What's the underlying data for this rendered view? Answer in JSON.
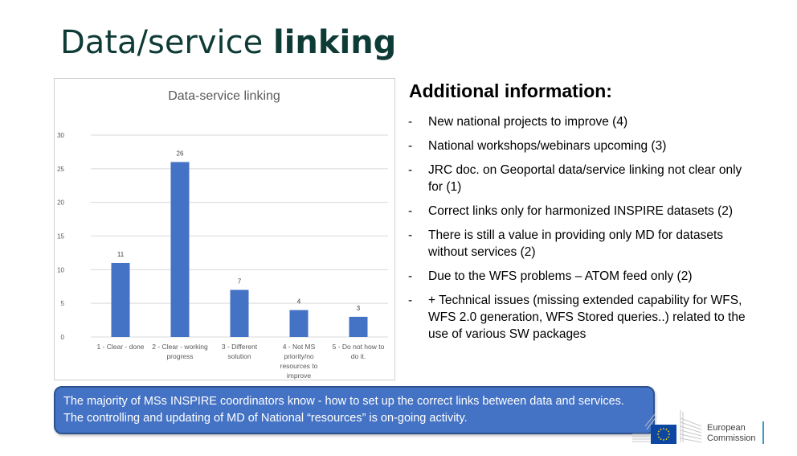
{
  "slide": {
    "title_regular": "Data/service ",
    "title_bold": "linking"
  },
  "chart_data": {
    "type": "bar",
    "title": "Data-service linking",
    "categories": [
      [
        "1 - Clear - done"
      ],
      [
        "2 - Clear - working",
        "progress"
      ],
      [
        "3 - Different",
        "solution"
      ],
      [
        "4 - Not MS",
        "priority/no",
        "resources to",
        "improve"
      ],
      [
        "5 - Do not how to",
        "do it."
      ]
    ],
    "values": [
      11,
      26,
      7,
      4,
      3
    ],
    "data_labels": [
      "11",
      "26",
      "7",
      "4",
      "3"
    ],
    "ylim": [
      0,
      30
    ],
    "yticks": [
      0,
      5,
      10,
      15,
      20,
      25,
      30
    ],
    "grid": true,
    "bar_color": "#4472c4",
    "xlabel": "",
    "ylabel": ""
  },
  "info": {
    "heading": "Additional information:",
    "bullet": "-",
    "items": [
      "New national projects to improve  (4)",
      "National workshops/webinars upcoming (3)",
      "JRC doc. on Geoportal data/service linking not clear only for (1)",
      "Correct links only for harmonized INSPIRE datasets (2)",
      "There is still a value in providing only MD for datasets without services (2)",
      "Due to the WFS problems – ATOM feed only (2)",
      "+  Technical issues (missing extended capability for WFS, WFS 2.0 generation, WFS Stored queries..) related to the use of various SW packages"
    ]
  },
  "callout": {
    "text": "The majority of MSs INSPIRE coordinators know - how to set up the correct links between data and services. The controlling and updating of MD of National “resources” is on-going activity."
  },
  "logo": {
    "line1": "European",
    "line2": "Commission",
    "icon": "eu-flag-building-icon"
  },
  "colors": {
    "title": "#0f3b36",
    "bar": "#4472c4",
    "callout_bg": "#4472c4"
  }
}
